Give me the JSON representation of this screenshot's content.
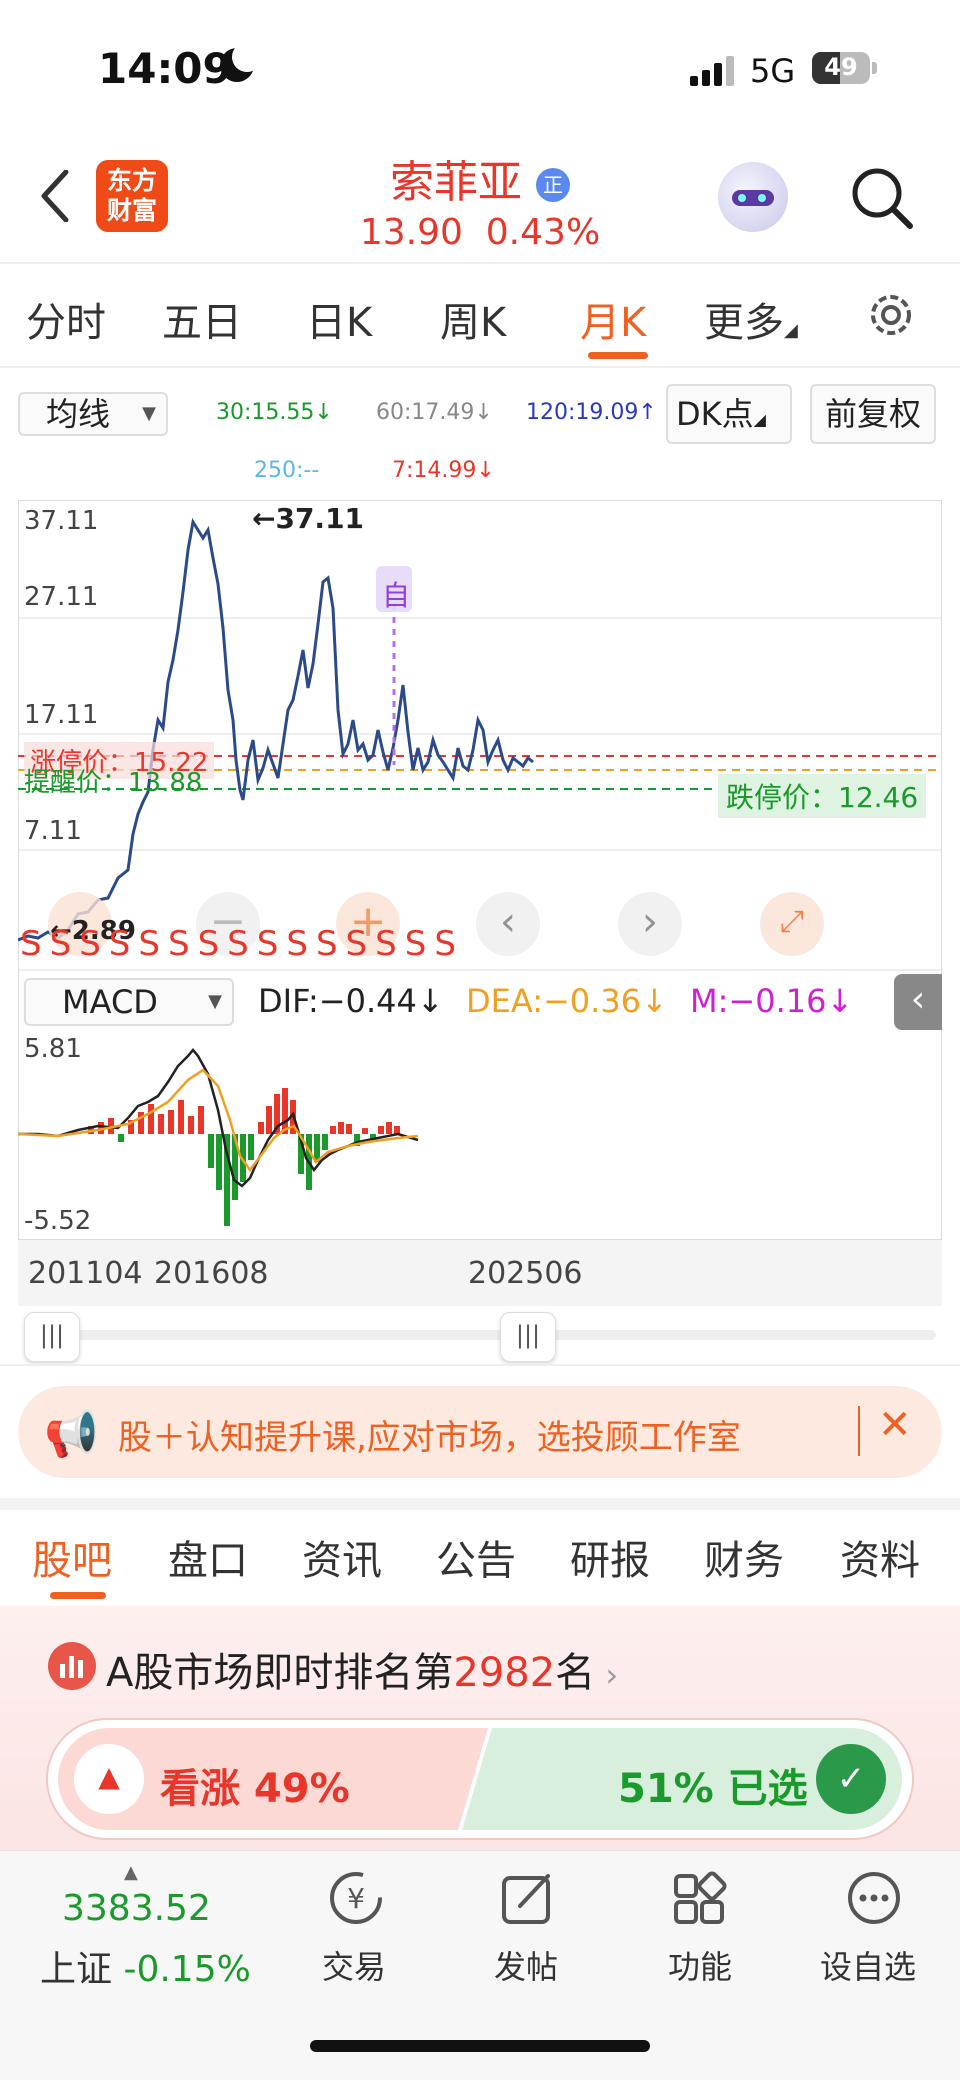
{
  "status": {
    "time": "14:09",
    "network": "5G",
    "battery": "49"
  },
  "header": {
    "name": "索菲亚",
    "badge": "正",
    "price": "13.90",
    "change": "0.43%",
    "logo_line1": "东方",
    "logo_line2": "财富"
  },
  "tabs": [
    {
      "label": "分时"
    },
    {
      "label": "五日"
    },
    {
      "label": "日K"
    },
    {
      "label": "周K"
    },
    {
      "label": "月K",
      "active": true
    },
    {
      "label": "更多"
    }
  ],
  "ma_row": {
    "selector": "均线",
    "ma30": "30:15.55",
    "ma60": "60:17.49",
    "ma120": "120:19.09",
    "dk": "DK点",
    "fq": "前复权",
    "ma250": "250:--",
    "ma7": "7:14.99"
  },
  "chart": {
    "y_labels": [
      "37.11",
      "27.11",
      "17.11",
      "7.11"
    ],
    "high_label": "37.11",
    "low_label": "2.89",
    "limit_up": "涨停价：15.22",
    "remind": "提醒价：13.88",
    "limit_down": "跌停价：12.46",
    "self_marker": "自",
    "signal": "S"
  },
  "macd": {
    "selector": "MACD",
    "dif": "DIF:−0.44",
    "dea": "DEA:−0.36",
    "m": "M:−0.16",
    "top": "5.81",
    "bottom": "-5.52"
  },
  "x_labels": [
    "201104",
    "201608",
    "202506"
  ],
  "banner": {
    "text": "股＋认知提升课,应对市场，选投顾工作室"
  },
  "sub_tabs": [
    {
      "label": "股吧",
      "active": true
    },
    {
      "label": "盘口"
    },
    {
      "label": "资讯"
    },
    {
      "label": "公告"
    },
    {
      "label": "研报"
    },
    {
      "label": "财务"
    },
    {
      "label": "资料"
    }
  ],
  "ranking": {
    "prefix": "A股市场即时排名第",
    "rank": "2982",
    "suffix": "名"
  },
  "vote": {
    "bull": "看涨 49%",
    "bear": "51% 已选",
    "bull_pct": 0.49
  },
  "bottom_nav": {
    "index_value": "3383.52",
    "index_name": "上证",
    "index_change": "-0.15%",
    "items": [
      {
        "label": "交易"
      },
      {
        "label": "发帖"
      },
      {
        "label": "功能"
      },
      {
        "label": "设自选"
      }
    ]
  },
  "colors": {
    "accent": "#f06020",
    "up": "#e8362a",
    "down": "#1a9a2a",
    "line": "#2a4a8a",
    "dea": "#f0a020",
    "m": "#d020d0"
  }
}
